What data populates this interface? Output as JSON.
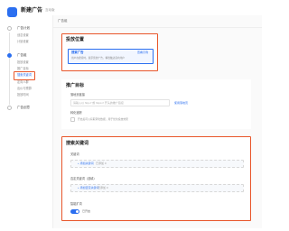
{
  "header": {
    "title": "新建广告",
    "tag": "互动版"
  },
  "sidebar": {
    "steps": [
      {
        "label": "广告计划",
        "subs": [
          "创意设置",
          "计划设置"
        ]
      },
      {
        "label": "广告组",
        "subs": [
          "投放设置",
          "推广目标",
          "搜索关键词",
          "定向人群",
          "出价与预算",
          "投放时间"
        ]
      },
      {
        "label": "广告创意",
        "subs": []
      }
    ],
    "active_sub": "搜索关键词"
  },
  "main": {
    "breadcrumb": "广告组",
    "placement": {
      "title": "投放位置",
      "option_label": "搜索广告",
      "option_desc": "用户在搜索时，展示您的广告，精准触达意向用户",
      "option_link": "查看示例"
    },
    "goal": {
      "title": "推广目标",
      "field_label": "落地页链接",
      "field_placeholder": "请输入以 http:// 或 https:// 开头的推广链接",
      "field_link": "使用落地页",
      "switch_label": "转化追踪",
      "switch_hint": "开启后可以获取转化数据，用于优化投放效果"
    },
    "keywords": {
      "title": "搜索关键词",
      "group1_label": "关键词",
      "group1_add": "+ 添加关键词",
      "group1_count": "已添加 0",
      "group2_label": "否定关键词（选填）",
      "group2_add": "+ 添加否定关键词",
      "group2_count": "已添加 0",
      "smart_label": "智能扩词",
      "smart_state": "已开启"
    }
  }
}
